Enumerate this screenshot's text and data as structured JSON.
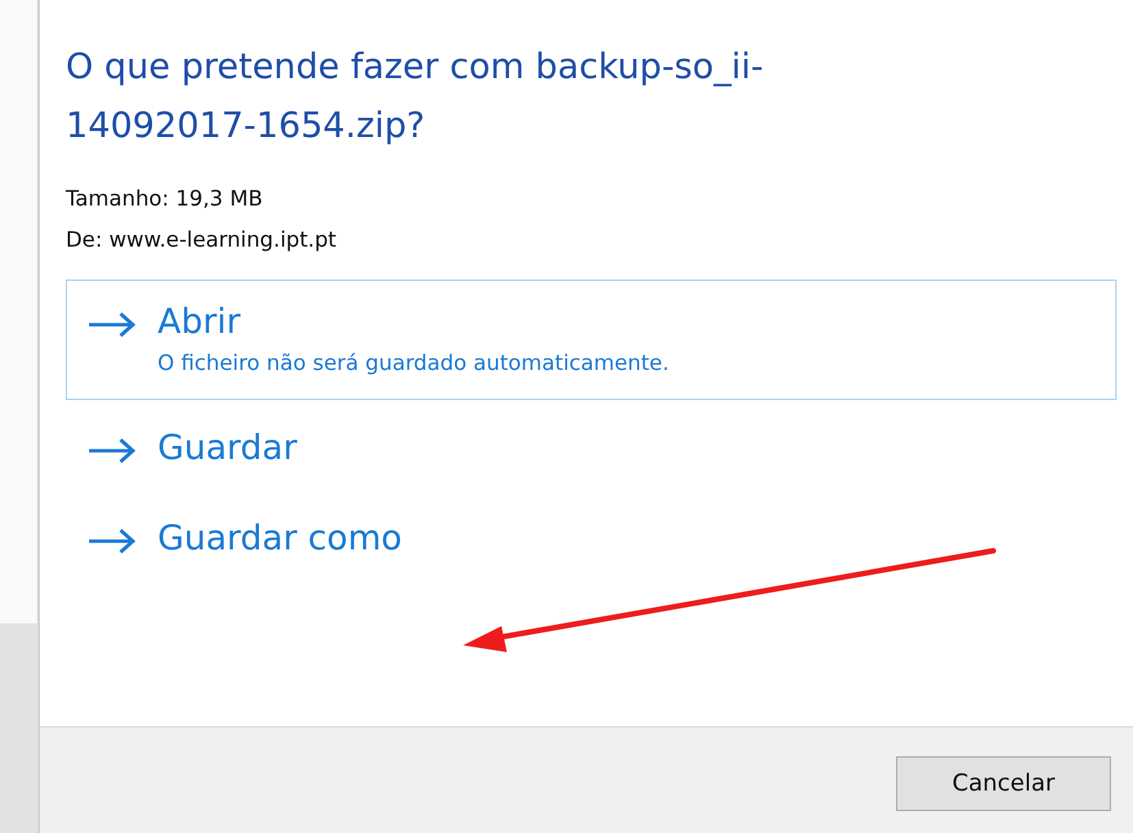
{
  "dialog": {
    "title": "O que pretende fazer com backup-so_ii-14092017-1654.zip?",
    "details": [
      "Tamanho: 19,3 MB",
      "De: www.e-learning.ipt.pt"
    ],
    "options": [
      {
        "label": "Abrir",
        "description": "O ficheiro não será guardado automaticamente.",
        "selected": true
      },
      {
        "label": "Guardar",
        "selected": false
      },
      {
        "label": "Guardar como",
        "selected": false
      }
    ],
    "buttons": [
      "Cancelar"
    ]
  }
}
